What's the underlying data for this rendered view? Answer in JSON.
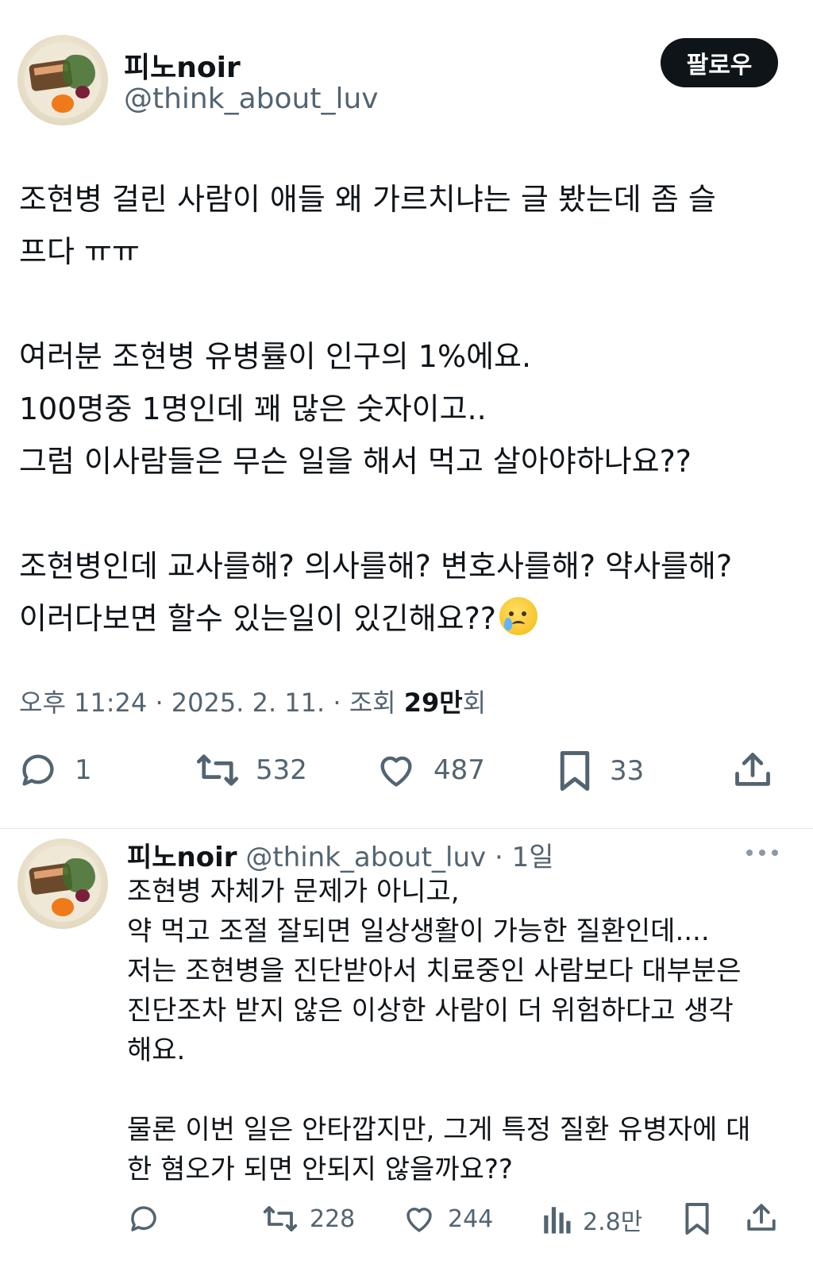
{
  "post": {
    "author_name": "피노noir",
    "author_handle": "@think_about_luv",
    "follow_label": "팔로우",
    "lines": [
      "조현병 걸린 사람이 애들 왜 가르치냐는 글 봤는데 좀 슬",
      "프다 ㅠㅠ",
      "",
      "여러분 조현병 유병률이 인구의 1%에요.",
      "100명중 1명인데 꽤 많은 숫자이고..",
      "그럼 이사람들은 무슨 일을 해서 먹고 살아야하나요??",
      "",
      "조현병인데 교사를해? 의사를해? 변호사를해? 약사를해?",
      "이러다보면 할수 있는일이 있긴해요??"
    ],
    "emoji": "face-holding-back-tears",
    "time": "오후 11:24",
    "date": "2025. 2. 11.",
    "views_prefix": "조회",
    "views_count": "29만",
    "views_suffix": "회",
    "replies": "1",
    "reposts": "532",
    "likes": "487",
    "bookmarks": "33"
  },
  "reply": {
    "author_name": "피노noir",
    "author_handle": "@think_about_luv",
    "age": "1일",
    "lines": [
      "조현병 자체가 문제가 아니고,",
      "약 먹고 조절 잘되면 일상생활이 가능한 질환인데....",
      "저는 조현병을 진단받아서 치료중인 사람보다 대부분은",
      "진단조차 받지 않은 이상한 사람이 더 위험하다고 생각",
      "해요.",
      "",
      "물론 이번 일은 안타깝지만, 그게 특정 질환 유병자에 대",
      "한 혐오가 되면 안되지 않을까요??"
    ],
    "reposts": "228",
    "likes": "244",
    "views": "2.8만"
  },
  "colors": {
    "text": "#0f1419",
    "secondary": "#536471",
    "button_bg": "#0f1419",
    "divider": "#e1e5e9"
  }
}
